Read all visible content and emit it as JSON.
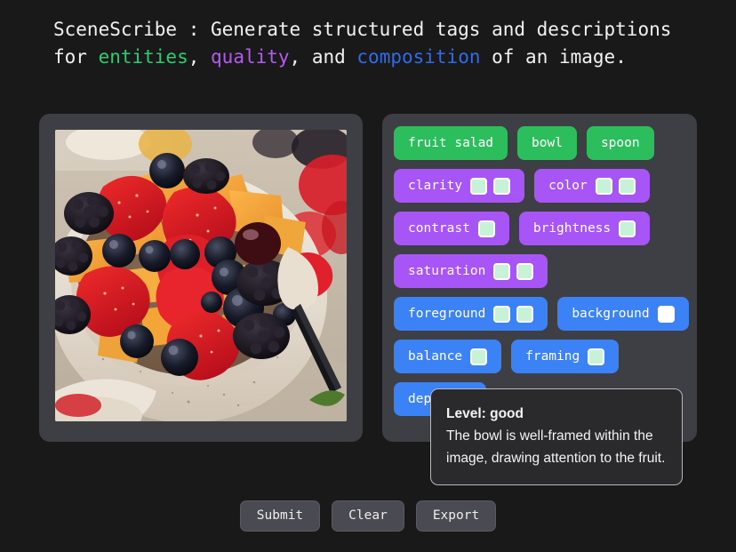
{
  "header": {
    "part1": "SceneScribe : Generate structured tags and descriptions for ",
    "kw_entities": "entities",
    "sep1": ", ",
    "kw_quality": "quality",
    "sep2": ", and ",
    "kw_composition": "composition",
    "part_end": " of an image."
  },
  "image": {
    "alt": "fruit salad in a speckled ceramic bowl with strawberries, blackberries, blueberries, melon cubes and a dark spoon"
  },
  "tag_rows": [
    [
      {
        "label": "fruit salad",
        "category": "entity",
        "chips": []
      },
      {
        "label": "bowl",
        "category": "entity",
        "chips": []
      },
      {
        "label": "spoon",
        "category": "entity",
        "chips": []
      }
    ],
    [
      {
        "label": "clarity",
        "category": "quality",
        "chips": [
          "filled",
          "filled"
        ]
      },
      {
        "label": "color",
        "category": "quality",
        "chips": [
          "filled",
          "filled"
        ]
      }
    ],
    [
      {
        "label": "contrast",
        "category": "quality",
        "chips": [
          "filled"
        ]
      },
      {
        "label": "brightness",
        "category": "quality",
        "chips": [
          "filled"
        ]
      }
    ],
    [
      {
        "label": "saturation",
        "category": "quality",
        "chips": [
          "filled",
          "filled"
        ]
      }
    ],
    [
      {
        "label": "foreground",
        "category": "composition",
        "chips": [
          "filled",
          "filled"
        ]
      },
      {
        "label": "background",
        "category": "composition",
        "chips": [
          "blank"
        ]
      }
    ],
    [
      {
        "label": "balance",
        "category": "composition",
        "chips": [
          "filled"
        ]
      },
      {
        "label": "framing",
        "category": "composition",
        "chips": [
          "filled"
        ]
      }
    ],
    [
      {
        "label": "depth",
        "category": "composition",
        "chips": [
          "filled"
        ]
      }
    ]
  ],
  "tooltip": {
    "title": "Level: good",
    "body": "The bowl is well-framed within the image, drawing attention to the fruit."
  },
  "buttons": [
    {
      "label": "Submit",
      "name": "submit-button"
    },
    {
      "label": "Clear",
      "name": "clear-button"
    },
    {
      "label": "Export",
      "name": "export-button"
    }
  ],
  "colors": {
    "entity": "#2cbe5d",
    "quality": "#a855f7",
    "composition": "#3b82f6",
    "chip_filled": "#c7f2d8",
    "chip_blank": "#ffffff",
    "panel": "#3e3e45",
    "page_background": "#191919"
  }
}
